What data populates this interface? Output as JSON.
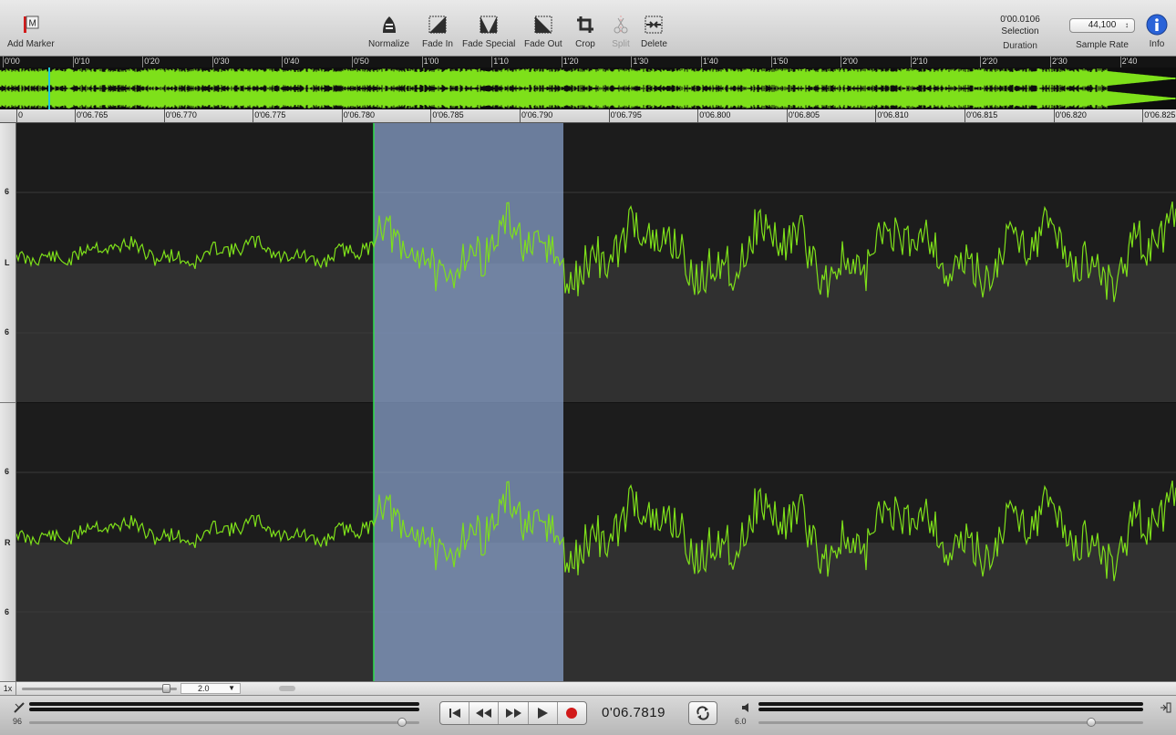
{
  "toolbar": {
    "add_marker": "Add Marker",
    "normalize": "Normalize",
    "fade_in": "Fade In",
    "fade_special": "Fade Special",
    "fade_out": "Fade Out",
    "crop": "Crop",
    "split": "Split",
    "delete": "Delete",
    "selection_value": "0'00.0106",
    "selection_label": "Selection",
    "duration_label": "Duration",
    "sample_rate_value": "44,100",
    "sample_rate_label": "Sample Rate",
    "info_label": "Info"
  },
  "overview_ruler": [
    "0'00",
    "0'10",
    "0'20",
    "0'30",
    "0'40",
    "0'50",
    "1'00",
    "1'10",
    "1'20",
    "1'30",
    "1'40",
    "1'50",
    "2'00",
    "2'10",
    "2'20",
    "2'30",
    "2'40"
  ],
  "detail_ruler": [
    "0",
    "0'06.765",
    "0'06.770",
    "0'06.775",
    "0'06.780",
    "0'06.785",
    "0'06.790",
    "0'06.795",
    "0'06.800",
    "0'06.805",
    "0'06.810",
    "0'06.815",
    "0'06.820",
    "0'06.825"
  ],
  "channels": {
    "left_label": "L",
    "right_label": "R",
    "level_label": "6"
  },
  "zoom": {
    "label": "1x",
    "value": "2.0"
  },
  "transport": {
    "time": "0'06.7819",
    "input_level": "96",
    "output_level": "6.0"
  },
  "colors": {
    "waveform": "#7ee01a",
    "selection": "#8ba4cf",
    "background": "#1d1d1d"
  }
}
